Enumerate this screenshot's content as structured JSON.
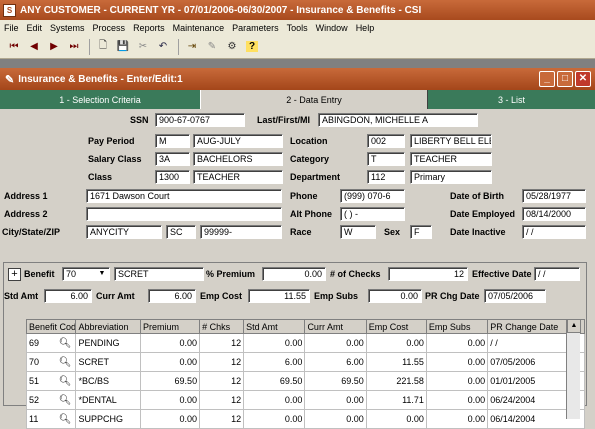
{
  "app": {
    "title": "ANY CUSTOMER - CURRENT YR - 07/01/2006-06/30/2007 - Insurance & Benefits - CSI",
    "icon_glyph": "S"
  },
  "menu": [
    "File",
    "Edit",
    "Systems",
    "Process",
    "Reports",
    "Maintenance",
    "Parameters",
    "Tools",
    "Window",
    "Help"
  ],
  "window": {
    "title": "Insurance & Benefits - Enter/Edit:1",
    "minimize": "_",
    "restore": "□",
    "close": "✕"
  },
  "tabs": [
    {
      "label": "1 - Selection Criteria"
    },
    {
      "label": "2 - Data Entry"
    },
    {
      "label": "3 - List"
    }
  ],
  "employee": {
    "ssn_label": "SSN",
    "ssn": "900-67-0767",
    "name_label": "Last/First/MI",
    "name": "ABINGDON, MICHELLE A",
    "pay_period_label": "Pay Period",
    "pay_period_code": "M",
    "pay_period": "AUG-JULY",
    "location_label": "Location",
    "location_code": "002",
    "location": "LIBERTY BELL ELEME",
    "salary_class_label": "Salary Class",
    "salary_class_code": "3A",
    "salary_class": "BACHELORS",
    "category_label": "Category",
    "category_code": "T",
    "category": "TEACHER",
    "class_label": "Class",
    "class_code": "1300",
    "class": "TEACHER",
    "department_label": "Department",
    "department_code": "112",
    "department": "Primary",
    "address1_label": "Address 1",
    "address1": "1671 Dawson Court",
    "phone_label": "Phone",
    "phone": "(999) 070-6",
    "dob_label": "Date of Birth",
    "dob": "05/28/1977",
    "address2_label": "Address 2",
    "address2": "",
    "alt_phone_label": "Alt Phone",
    "alt_phone": "( )  -",
    "date_employed_label": "Date Employed",
    "date_employed": "08/14/2000",
    "city_label": "City/State/ZIP",
    "city": "ANYCITY",
    "state": "SC",
    "zip": "99999-",
    "race_label": "Race",
    "race": "W",
    "sex_label": "Sex",
    "sex": "F",
    "date_inactive_label": "Date Inactive",
    "date_inactive": "/ /"
  },
  "benefit": {
    "benefit_label": "Benefit",
    "benefit_code": "70",
    "benefit_name": "SCRET",
    "pct_premium_label": "% Premium",
    "pct_premium": "0.00",
    "num_checks_label": "# of Checks",
    "num_checks": "12",
    "effective_date_label": "Effective Date",
    "effective_date": "/ /",
    "std_amt_label": "Std Amt",
    "std_amt": "6.00",
    "curr_amt_label": "Curr Amt",
    "curr_amt": "6.00",
    "emp_cost_label": "Emp Cost",
    "emp_cost": "11.55",
    "emp_subs_label": "Emp Subs",
    "emp_subs": "0.00",
    "pr_chg_date_label": "PR Chg Date",
    "pr_chg_date": "07/05/2006"
  },
  "grid": {
    "columns": [
      "Benefit Code",
      "Abbreviation",
      "Premium",
      "# Chks",
      "Std Amt",
      "Curr Amt",
      "Emp Cost",
      "Emp Subs",
      "PR Change Date"
    ],
    "rows": [
      [
        "69",
        "PENDING",
        "0.00",
        "12",
        "0.00",
        "0.00",
        "0.00",
        "0.00",
        "/ /"
      ],
      [
        "70",
        "SCRET",
        "0.00",
        "12",
        "6.00",
        "6.00",
        "11.55",
        "0.00",
        "07/05/2006"
      ],
      [
        "51",
        "*BC/BS",
        "69.50",
        "12",
        "69.50",
        "69.50",
        "221.58",
        "0.00",
        "01/01/2005"
      ],
      [
        "52",
        "*DENTAL",
        "0.00",
        "12",
        "0.00",
        "0.00",
        "11.71",
        "0.00",
        "06/24/2004"
      ],
      [
        "11",
        "SUPPCHG",
        "0.00",
        "12",
        "0.00",
        "0.00",
        "0.00",
        "0.00",
        "06/14/2004"
      ]
    ],
    "selected_row": 1
  },
  "colors": {
    "titlebar": "#b4522a",
    "tab_inactive": "#3a7a5a",
    "panel": "#d4d0c8"
  }
}
